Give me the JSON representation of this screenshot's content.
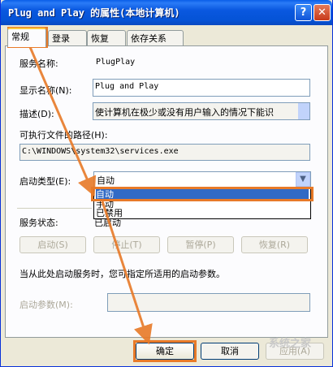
{
  "window": {
    "title": "Plug and Play 的属性(本地计算机)",
    "help_glyph": "?",
    "close_glyph": "✕"
  },
  "tabs": [
    "常规",
    "登录",
    "恢复",
    "依存关系"
  ],
  "general": {
    "service_name_label": "服务名称:",
    "service_name_value": "PlugPlay",
    "display_name_label": "显示名称(N):",
    "display_name_value": "Plug and Play",
    "description_label": "描述(D):",
    "description_value": "使计算机在极少或没有用户输入的情况下能识",
    "exec_path_label": "可执行文件的路径(H):",
    "exec_path_value": "C:\\WINDOWS\\system32\\services.exe",
    "startup_type_label": "启动类型(E):",
    "startup_type_value": "自动",
    "startup_options": [
      "自动",
      "手动",
      "已禁用"
    ],
    "service_status_label": "服务状态:",
    "service_status_value": "已启动",
    "buttons": {
      "start": "启动(S)",
      "stop": "停止(T)",
      "pause": "暂停(P)",
      "resume": "恢复(R)"
    },
    "hint": "当从此处启动服务时，您可指定所适用的启动参数。",
    "start_params_label": "启动参数(M):"
  },
  "footer": {
    "ok": "确定",
    "cancel": "取消",
    "apply": "应用(A)"
  },
  "watermark": "系统之家",
  "colors": {
    "title_bar": "#0a58e0",
    "highlight": "#e87a28",
    "selection": "#316ac5"
  }
}
